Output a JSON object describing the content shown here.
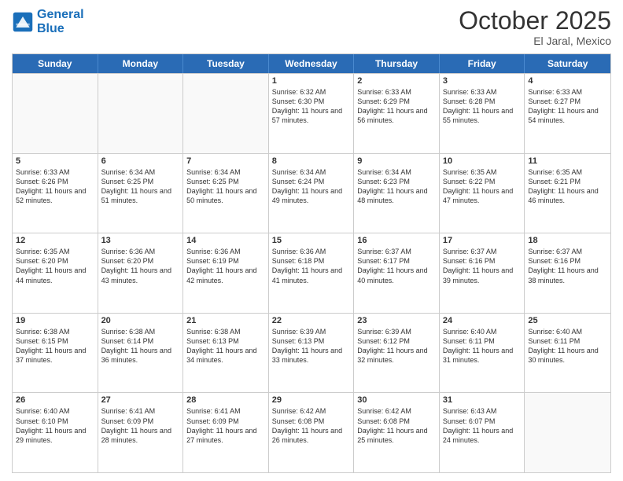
{
  "header": {
    "logo_line1": "General",
    "logo_line2": "Blue",
    "month": "October 2025",
    "location": "El Jaral, Mexico"
  },
  "weekdays": [
    "Sunday",
    "Monday",
    "Tuesday",
    "Wednesday",
    "Thursday",
    "Friday",
    "Saturday"
  ],
  "rows": [
    [
      {
        "day": "",
        "info": ""
      },
      {
        "day": "",
        "info": ""
      },
      {
        "day": "",
        "info": ""
      },
      {
        "day": "1",
        "info": "Sunrise: 6:32 AM\nSunset: 6:30 PM\nDaylight: 11 hours and 57 minutes."
      },
      {
        "day": "2",
        "info": "Sunrise: 6:33 AM\nSunset: 6:29 PM\nDaylight: 11 hours and 56 minutes."
      },
      {
        "day": "3",
        "info": "Sunrise: 6:33 AM\nSunset: 6:28 PM\nDaylight: 11 hours and 55 minutes."
      },
      {
        "day": "4",
        "info": "Sunrise: 6:33 AM\nSunset: 6:27 PM\nDaylight: 11 hours and 54 minutes."
      }
    ],
    [
      {
        "day": "5",
        "info": "Sunrise: 6:33 AM\nSunset: 6:26 PM\nDaylight: 11 hours and 52 minutes."
      },
      {
        "day": "6",
        "info": "Sunrise: 6:34 AM\nSunset: 6:25 PM\nDaylight: 11 hours and 51 minutes."
      },
      {
        "day": "7",
        "info": "Sunrise: 6:34 AM\nSunset: 6:25 PM\nDaylight: 11 hours and 50 minutes."
      },
      {
        "day": "8",
        "info": "Sunrise: 6:34 AM\nSunset: 6:24 PM\nDaylight: 11 hours and 49 minutes."
      },
      {
        "day": "9",
        "info": "Sunrise: 6:34 AM\nSunset: 6:23 PM\nDaylight: 11 hours and 48 minutes."
      },
      {
        "day": "10",
        "info": "Sunrise: 6:35 AM\nSunset: 6:22 PM\nDaylight: 11 hours and 47 minutes."
      },
      {
        "day": "11",
        "info": "Sunrise: 6:35 AM\nSunset: 6:21 PM\nDaylight: 11 hours and 46 minutes."
      }
    ],
    [
      {
        "day": "12",
        "info": "Sunrise: 6:35 AM\nSunset: 6:20 PM\nDaylight: 11 hours and 44 minutes."
      },
      {
        "day": "13",
        "info": "Sunrise: 6:36 AM\nSunset: 6:20 PM\nDaylight: 11 hours and 43 minutes."
      },
      {
        "day": "14",
        "info": "Sunrise: 6:36 AM\nSunset: 6:19 PM\nDaylight: 11 hours and 42 minutes."
      },
      {
        "day": "15",
        "info": "Sunrise: 6:36 AM\nSunset: 6:18 PM\nDaylight: 11 hours and 41 minutes."
      },
      {
        "day": "16",
        "info": "Sunrise: 6:37 AM\nSunset: 6:17 PM\nDaylight: 11 hours and 40 minutes."
      },
      {
        "day": "17",
        "info": "Sunrise: 6:37 AM\nSunset: 6:16 PM\nDaylight: 11 hours and 39 minutes."
      },
      {
        "day": "18",
        "info": "Sunrise: 6:37 AM\nSunset: 6:16 PM\nDaylight: 11 hours and 38 minutes."
      }
    ],
    [
      {
        "day": "19",
        "info": "Sunrise: 6:38 AM\nSunset: 6:15 PM\nDaylight: 11 hours and 37 minutes."
      },
      {
        "day": "20",
        "info": "Sunrise: 6:38 AM\nSunset: 6:14 PM\nDaylight: 11 hours and 36 minutes."
      },
      {
        "day": "21",
        "info": "Sunrise: 6:38 AM\nSunset: 6:13 PM\nDaylight: 11 hours and 34 minutes."
      },
      {
        "day": "22",
        "info": "Sunrise: 6:39 AM\nSunset: 6:13 PM\nDaylight: 11 hours and 33 minutes."
      },
      {
        "day": "23",
        "info": "Sunrise: 6:39 AM\nSunset: 6:12 PM\nDaylight: 11 hours and 32 minutes."
      },
      {
        "day": "24",
        "info": "Sunrise: 6:40 AM\nSunset: 6:11 PM\nDaylight: 11 hours and 31 minutes."
      },
      {
        "day": "25",
        "info": "Sunrise: 6:40 AM\nSunset: 6:11 PM\nDaylight: 11 hours and 30 minutes."
      }
    ],
    [
      {
        "day": "26",
        "info": "Sunrise: 6:40 AM\nSunset: 6:10 PM\nDaylight: 11 hours and 29 minutes."
      },
      {
        "day": "27",
        "info": "Sunrise: 6:41 AM\nSunset: 6:09 PM\nDaylight: 11 hours and 28 minutes."
      },
      {
        "day": "28",
        "info": "Sunrise: 6:41 AM\nSunset: 6:09 PM\nDaylight: 11 hours and 27 minutes."
      },
      {
        "day": "29",
        "info": "Sunrise: 6:42 AM\nSunset: 6:08 PM\nDaylight: 11 hours and 26 minutes."
      },
      {
        "day": "30",
        "info": "Sunrise: 6:42 AM\nSunset: 6:08 PM\nDaylight: 11 hours and 25 minutes."
      },
      {
        "day": "31",
        "info": "Sunrise: 6:43 AM\nSunset: 6:07 PM\nDaylight: 11 hours and 24 minutes."
      },
      {
        "day": "",
        "info": ""
      }
    ]
  ]
}
